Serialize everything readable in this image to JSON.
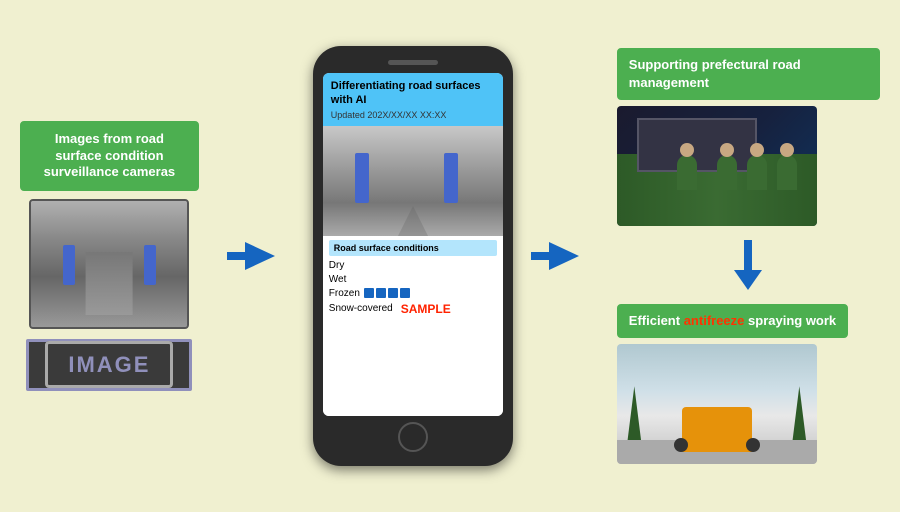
{
  "left": {
    "camera_label": "Images from road surface condition surveillance cameras",
    "image_label": "IMAGE"
  },
  "phone": {
    "title": "Differentiating road surfaces with AI",
    "updated": "Updated 202X/XX/XX XX:XX",
    "conditions_header": "Road surface conditions",
    "condition_dry": "Dry",
    "condition_wet": "Wet",
    "condition_frozen": "Frozen",
    "condition_snow": "Snow-covered",
    "sample_label": "SAMPLE"
  },
  "right": {
    "prefect_label": "Supporting prefectural road management",
    "antifreeze_label_before": "Efficient ",
    "antifreeze_word": "antifreeze",
    "antifreeze_label_after": " spraying work"
  },
  "arrows": {
    "right_color": "#1565c0",
    "down_color": "#1565c0"
  }
}
